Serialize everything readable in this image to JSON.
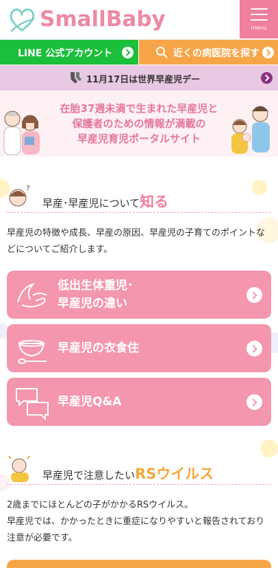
{
  "header": {
    "logo_text": "SmallBaby",
    "menu_label": "menu"
  },
  "top_buttons": {
    "line_label": "LINE 公式アカウント",
    "hospital_label": "近くの病医院を探す"
  },
  "notice": {
    "text": "11月17日は世界早産児デー"
  },
  "hero": {
    "line1": "在胎37週未満で生まれた早産児と",
    "line2": "保護者のための情報が満載の",
    "line3": "早産児育児ポータルサイト"
  },
  "section_about": {
    "title_prefix": "早産･早産児について",
    "title_emphasis": "知る",
    "description": "早産児の特徴や成長、早産の原因、早産児の子育てのポイントなどについてご紹介します。",
    "cards": [
      {
        "line1": "低出生体重児･",
        "line2": "早産児の違い"
      },
      {
        "line1": "早産児の衣食住",
        "line2": ""
      },
      {
        "line1": "早産児Q&A",
        "line2": ""
      }
    ]
  },
  "section_rs": {
    "title_prefix": "早産児で注意したい",
    "title_emphasis": "RSウイルス",
    "description_line1": "2歳までにほとんどの子がかかるRSウイルス。",
    "description_line2": "早産児では、かかったときに重症になりやすいと報告されており注意が必要です。"
  },
  "colors": {
    "brand_pink": "#ef7f9c",
    "line_green": "#1cbf3a",
    "orange": "#f6a548",
    "notice_purple": "#e9c8e4"
  }
}
